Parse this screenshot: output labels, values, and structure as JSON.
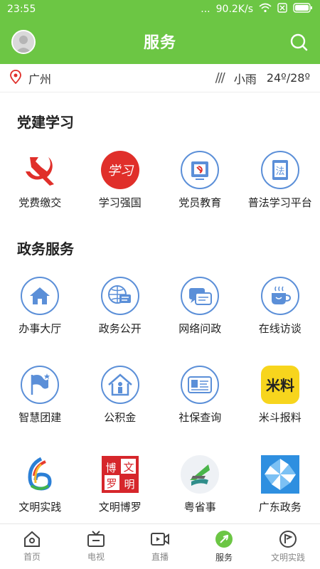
{
  "status_bar": {
    "time": "23:55",
    "dots": "...",
    "speed": "90.2K/s",
    "signal_icon": "wifi-icon",
    "battery_icon": "battery-icon"
  },
  "header": {
    "title": "服务",
    "avatar_icon": "avatar-icon",
    "search_icon": "search-icon"
  },
  "location_bar": {
    "city": "广州",
    "weather_symbol": "///",
    "weather": "小雨",
    "temperature": "24º/28º"
  },
  "sections": [
    {
      "title": "党建学习",
      "items": [
        {
          "label": "党费缴交",
          "icon": "party-flag-icon"
        },
        {
          "label": "学习强国",
          "icon": "xuexi-qiangguo-icon"
        },
        {
          "label": "党员教育",
          "icon": "party-education-icon"
        },
        {
          "label": "普法学习平台",
          "icon": "law-learning-icon"
        }
      ]
    },
    {
      "title": "政务服务",
      "items": [
        {
          "label": "办事大厅",
          "icon": "service-hall-icon"
        },
        {
          "label": "政务公开",
          "icon": "gov-open-icon"
        },
        {
          "label": "网络问政",
          "icon": "online-inquiry-icon"
        },
        {
          "label": "在线访谈",
          "icon": "online-interview-icon"
        },
        {
          "label": "智慧团建",
          "icon": "smart-league-icon"
        },
        {
          "label": "公积金",
          "icon": "housing-fund-icon"
        },
        {
          "label": "社保查询",
          "icon": "social-security-icon"
        },
        {
          "label": "米斗报料",
          "icon": "midou-report-icon",
          "glyph": "米料"
        },
        {
          "label": "文明实践",
          "icon": "civilization-practice-icon"
        },
        {
          "label": "文明博罗",
          "icon": "civilization-boluo-icon",
          "glyph": [
            "博",
            "文",
            "罗",
            "明"
          ]
        },
        {
          "label": "粤省事",
          "icon": "yue-sheng-shi-icon"
        },
        {
          "label": "广东政务",
          "icon": "guangdong-gov-icon"
        }
      ]
    }
  ],
  "tabs": [
    {
      "label": "首页",
      "icon": "home-icon",
      "active": false
    },
    {
      "label": "电视",
      "icon": "tv-icon",
      "active": false
    },
    {
      "label": "直播",
      "icon": "live-icon",
      "active": false
    },
    {
      "label": "服务",
      "icon": "service-icon",
      "active": true
    },
    {
      "label": "文明实践",
      "icon": "civilization-icon",
      "active": false
    }
  ],
  "colors": {
    "brand_green": "#6cc644",
    "icon_blue": "#5b8fd8",
    "party_red": "#e02f2a"
  }
}
